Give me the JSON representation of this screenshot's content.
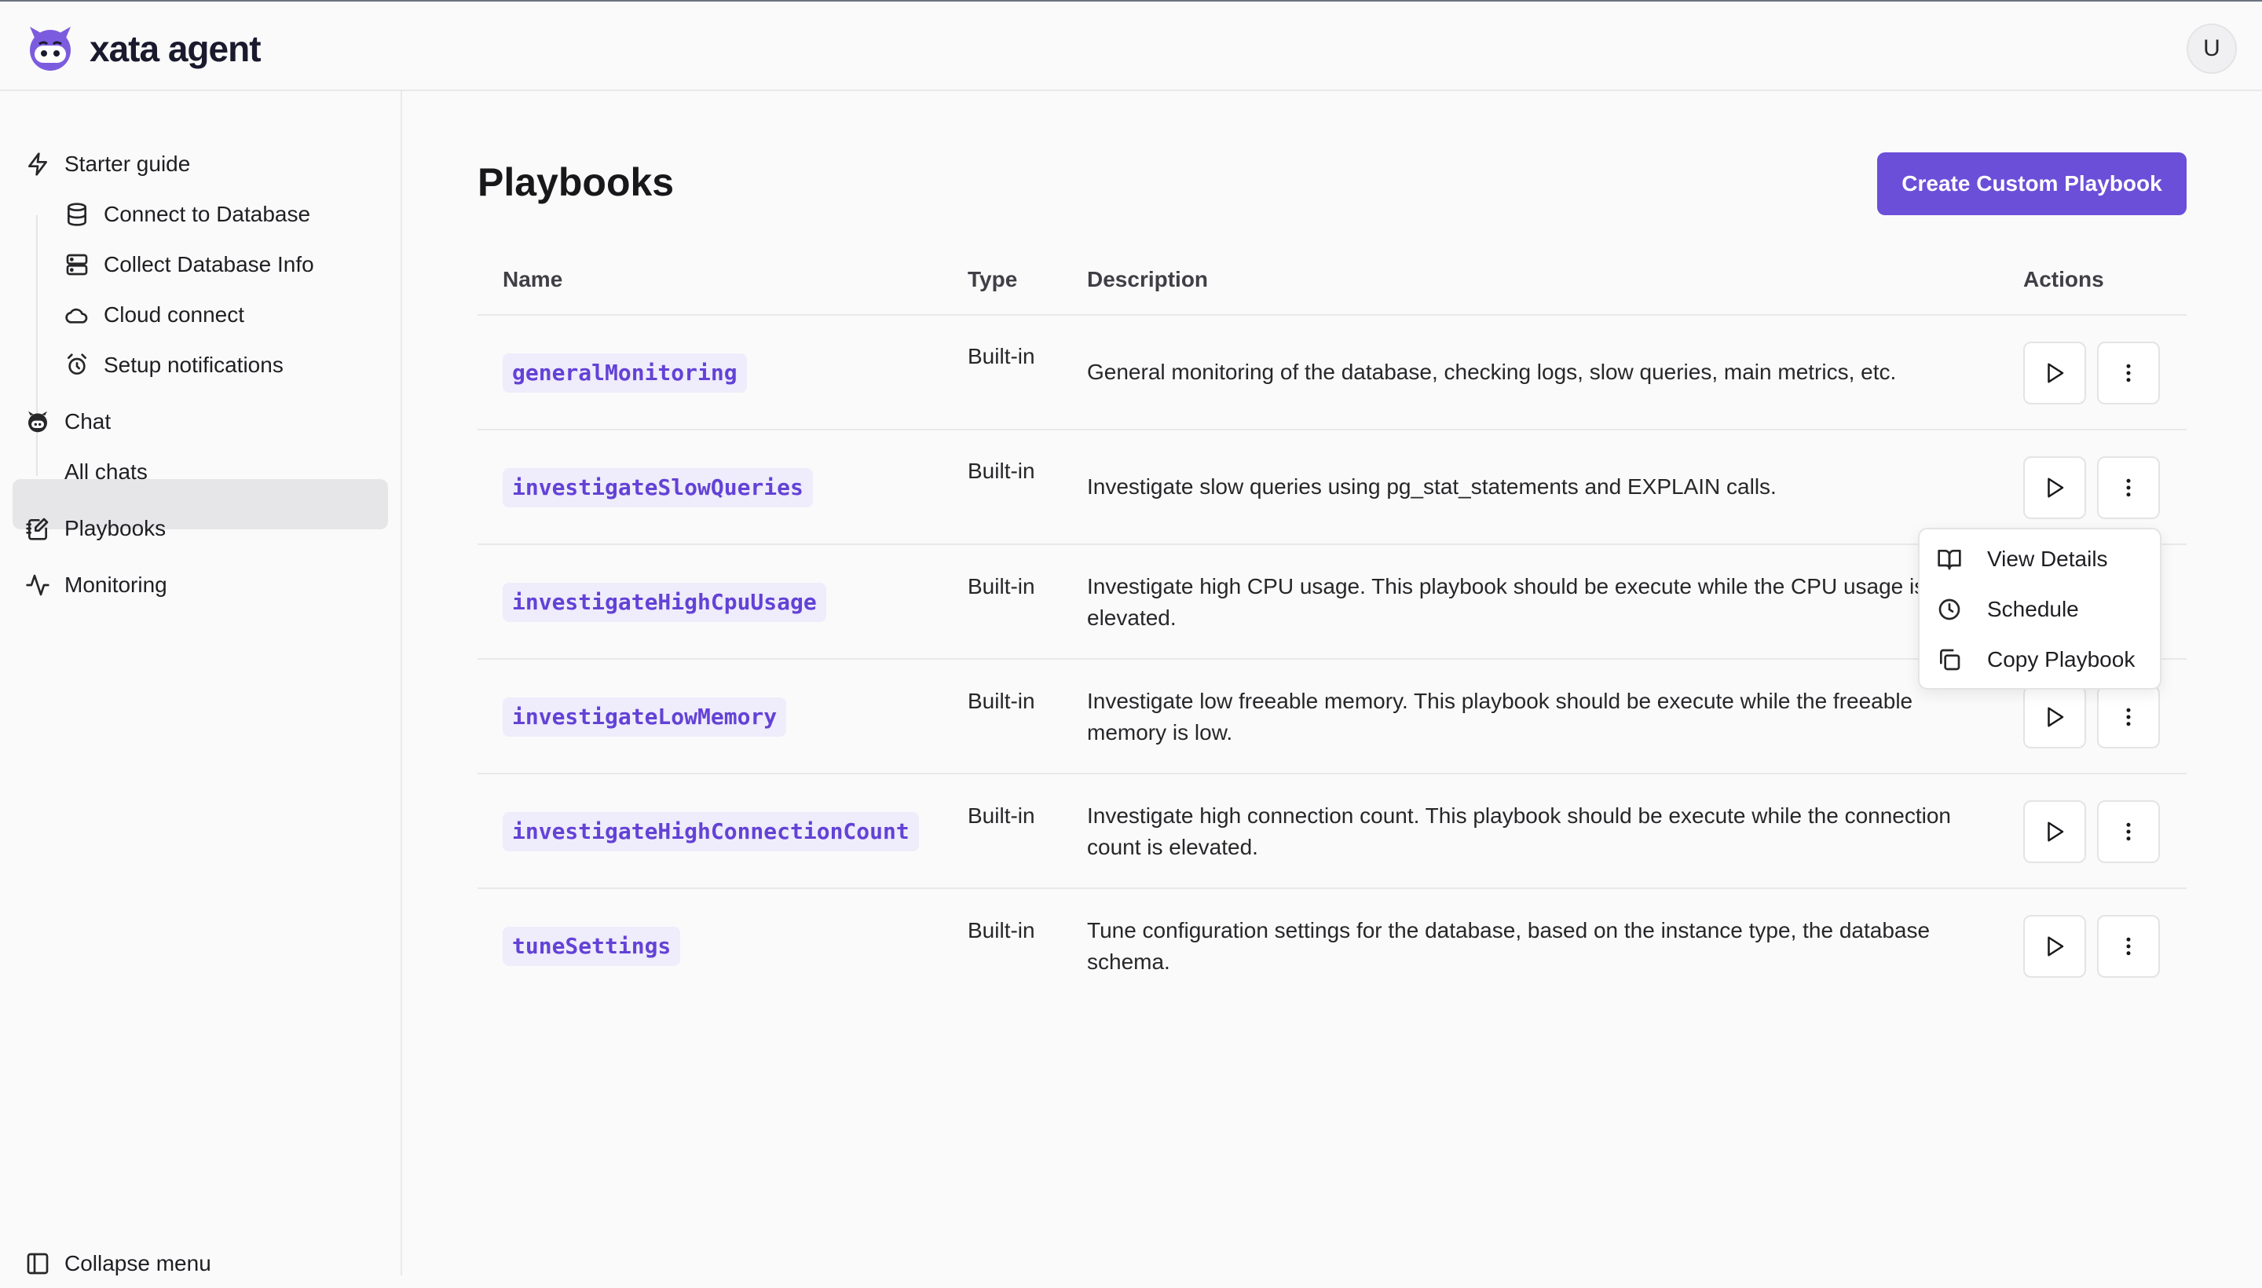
{
  "app": {
    "brand": "xata agent",
    "user_initial": "U"
  },
  "sidebar": {
    "starter_guide": "Starter guide",
    "starter_items": [
      {
        "label": "Connect to Database",
        "icon": "database-icon"
      },
      {
        "label": "Collect Database Info",
        "icon": "server-icon"
      },
      {
        "label": "Cloud connect",
        "icon": "cloud-icon"
      },
      {
        "label": "Setup notifications",
        "icon": "alarm-clock-icon"
      }
    ],
    "chat": "Chat",
    "all_chats": "All chats",
    "playbooks": "Playbooks",
    "monitoring": "Monitoring",
    "collapse": "Collapse menu",
    "active_item": "Playbooks"
  },
  "main": {
    "title": "Playbooks",
    "create_button": "Create Custom Playbook",
    "columns": {
      "name": "Name",
      "type": "Type",
      "description": "Description",
      "actions": "Actions"
    },
    "rows": [
      {
        "name": "generalMonitoring",
        "type": "Built-in",
        "description": "General monitoring of the database, checking logs, slow queries, main metrics, etc."
      },
      {
        "name": "investigateSlowQueries",
        "type": "Built-in",
        "description": "Investigate slow queries using pg_stat_statements and EXPLAIN calls."
      },
      {
        "name": "investigateHighCpuUsage",
        "type": "Built-in",
        "description": "Investigate high CPU usage. This playbook should be execute while the CPU usage is elevated."
      },
      {
        "name": "investigateLowMemory",
        "type": "Built-in",
        "description": "Investigate low freeable memory. This playbook should be execute while the freeable memory is low."
      },
      {
        "name": "investigateHighConnectionCount",
        "type": "Built-in",
        "description": "Investigate high connection count. This playbook should be execute while the connection count is elevated."
      },
      {
        "name": "tuneSettings",
        "type": "Built-in",
        "description": "Tune configuration settings for the database, based on the instance type, the database schema."
      }
    ]
  },
  "menu": {
    "items": [
      {
        "label": "View Details",
        "icon": "book-open-icon"
      },
      {
        "label": "Schedule",
        "icon": "clock-icon"
      },
      {
        "label": "Copy Playbook",
        "icon": "copy-icon"
      }
    ]
  },
  "colors": {
    "accent": "#6b4fd8",
    "pill_bg": "#efecfb",
    "pill_text": "#6342d6",
    "active_nav_bg": "#e6e6e8"
  }
}
